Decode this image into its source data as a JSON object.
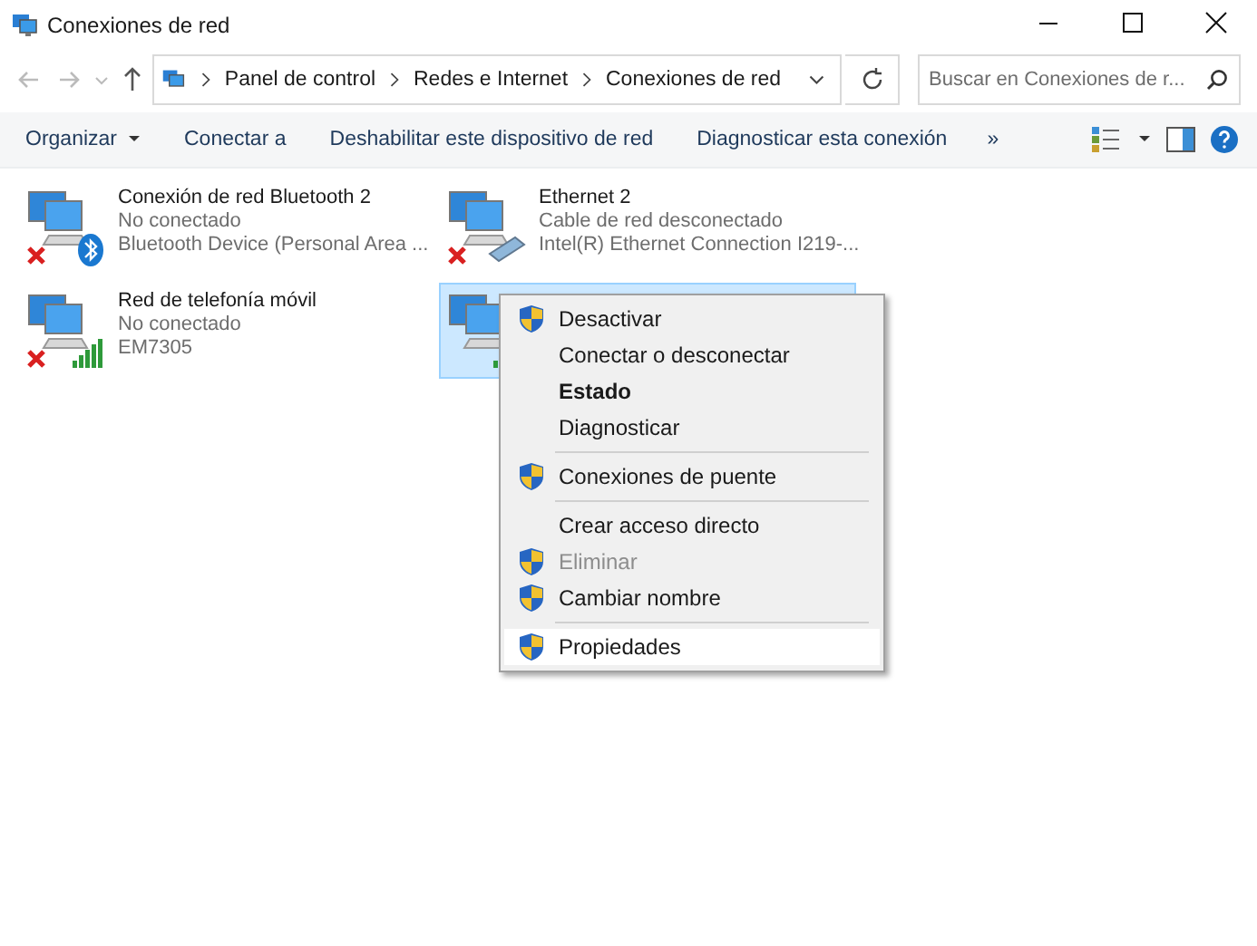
{
  "window": {
    "title": "Conexiones de red"
  },
  "address": {
    "crumbs": [
      "Panel de control",
      "Redes e Internet",
      "Conexiones de red"
    ]
  },
  "search": {
    "placeholder": "Buscar en Conexiones de r..."
  },
  "toolbar": {
    "items": [
      {
        "label": "Organizar",
        "dropdown": true
      },
      {
        "label": "Conectar a",
        "dropdown": false
      },
      {
        "label": "Deshabilitar este dispositivo de red",
        "dropdown": false
      },
      {
        "label": "Diagnosticar esta conexión",
        "dropdown": false
      }
    ],
    "more": "»"
  },
  "connections": [
    {
      "kind": "bluetooth",
      "name": "Conexión de red Bluetooth 2",
      "status": "No conectado",
      "device": "Bluetooth Device (Personal Area ...",
      "disconnected": true,
      "selected": false
    },
    {
      "kind": "ethernet",
      "name": "Ethernet 2",
      "status": "Cable de red desconectado",
      "device": "Intel(R) Ethernet Connection I219-...",
      "disconnected": true,
      "selected": false
    },
    {
      "kind": "mobile",
      "name": "Red de telefonía móvil",
      "status": "No conectado",
      "device": "EM7305",
      "disconnected": true,
      "selected": false
    },
    {
      "kind": "wifi",
      "disconnected": false,
      "selected": true
    }
  ],
  "context_menu": {
    "items": [
      {
        "kind": "item",
        "label": "Desactivar",
        "shield": true,
        "bold": false,
        "disabled": false,
        "selected": false
      },
      {
        "kind": "item",
        "label": "Conectar o desconectar",
        "shield": false,
        "bold": false,
        "disabled": false,
        "selected": false
      },
      {
        "kind": "item",
        "label": "Estado",
        "shield": false,
        "bold": true,
        "disabled": false,
        "selected": false
      },
      {
        "kind": "item",
        "label": "Diagnosticar",
        "shield": false,
        "bold": false,
        "disabled": false,
        "selected": false
      },
      {
        "kind": "separator"
      },
      {
        "kind": "item",
        "label": "Conexiones de puente",
        "shield": true,
        "bold": false,
        "disabled": false,
        "selected": false
      },
      {
        "kind": "separator"
      },
      {
        "kind": "item",
        "label": "Crear acceso directo",
        "shield": false,
        "bold": false,
        "disabled": false,
        "selected": false
      },
      {
        "kind": "item",
        "label": "Eliminar",
        "shield": true,
        "bold": false,
        "disabled": true,
        "selected": false
      },
      {
        "kind": "item",
        "label": "Cambiar nombre",
        "shield": true,
        "bold": false,
        "disabled": false,
        "selected": false
      },
      {
        "kind": "separator"
      },
      {
        "kind": "item",
        "label": "Propiedades",
        "shield": true,
        "bold": false,
        "disabled": false,
        "selected": true
      }
    ]
  }
}
